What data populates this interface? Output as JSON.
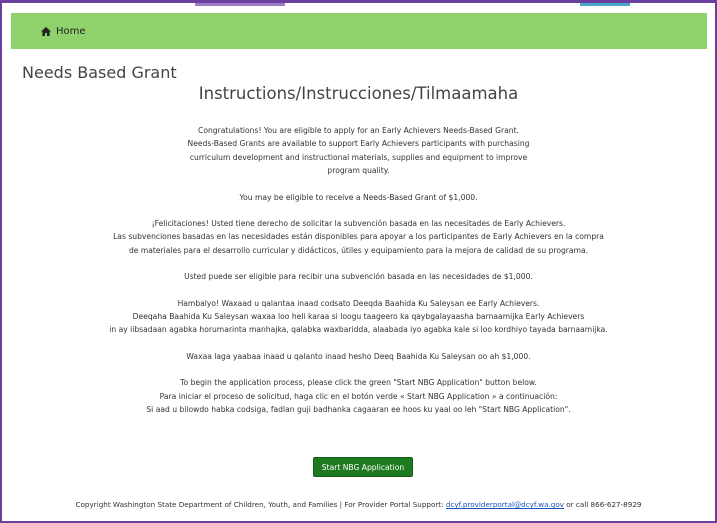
{
  "nav": {
    "home_label": "Home"
  },
  "page_title": "Needs Based Grant",
  "instructions_title": "Instructions/Instrucciones/Tilmaamaha",
  "english": {
    "line1": "Congratulations! You are eligible to apply for an Early Achievers Needs-Based Grant.",
    "line2": "Needs-Based Grants are available to support Early Achievers participants with purchasing",
    "line3": "curriculum development and instructional materials, supplies and equipment to improve",
    "line4": "program quality.",
    "amount": "You may be eligible to receive a Needs-Based Grant of $1,000."
  },
  "spanish": {
    "line1": "¡Felicitaciones! Usted tiene derecho de solicitar la subvención basada en las necesitades de Early Achievers.",
    "line2": "Las subvenciones basadas en las necesidades están disponibles para apoyar a los participantes de Early Achievers en la compra",
    "line3": "de materiales para el desarrollo curricular y didácticos, útiles y equipamiento para la mejora de calidad de su programa.",
    "amount": "Usted puede ser eligible para recibir una subvención basada en las necesidades de $1,000."
  },
  "somali": {
    "line1": "Hambalyo! Waxaad u qalantaa inaad codsato Deeqda Baahida Ku Saleysan ee Early Achievers.",
    "line2": "Deeqaha Baahida Ku Saleysan waxaa loo heli karaa si loogu taageero ka qaybgalayaasha barnaamijka Early Achievers",
    "line3": "in ay iibsadaan agabka horumarinta manhajka, qalabka waxbaridda, alaabada iyo agabka kale si loo kordhiyo tayada barnaamijka.",
    "amount": "Waxaa laga yaabaa inaad u qalanto inaad hesho Deeq Baahida Ku Saleysan oo ah $1,000."
  },
  "begin": {
    "english": "To begin the application process, please click the green \"Start NBG Application\" button below.",
    "spanish": "Para iniciar el proceso de solicitud, haga clic en el botón verde « Start NBG Application » a continuación:",
    "somali": "Si aad u bilowdo habka codsiga, fadlan guji badhanka cagaaran ee hoos ku yaal oo leh \"Start NBG Application\"."
  },
  "start_button_label": "Start NBG Application",
  "footer": {
    "text_before": "Copyright Washington State Department of Children, Youth, and Families | For Provider Portal Support: ",
    "email": "dcyf.providerportal@dcyf.wa.gov",
    "text_after": " or call 866-627-8929"
  },
  "colors": {
    "navbar": "#8fd16a",
    "button": "#1e7a1e",
    "frame": "#6b3fa0",
    "link": "#1a55c4"
  },
  "icons": {
    "home": "home-icon"
  }
}
